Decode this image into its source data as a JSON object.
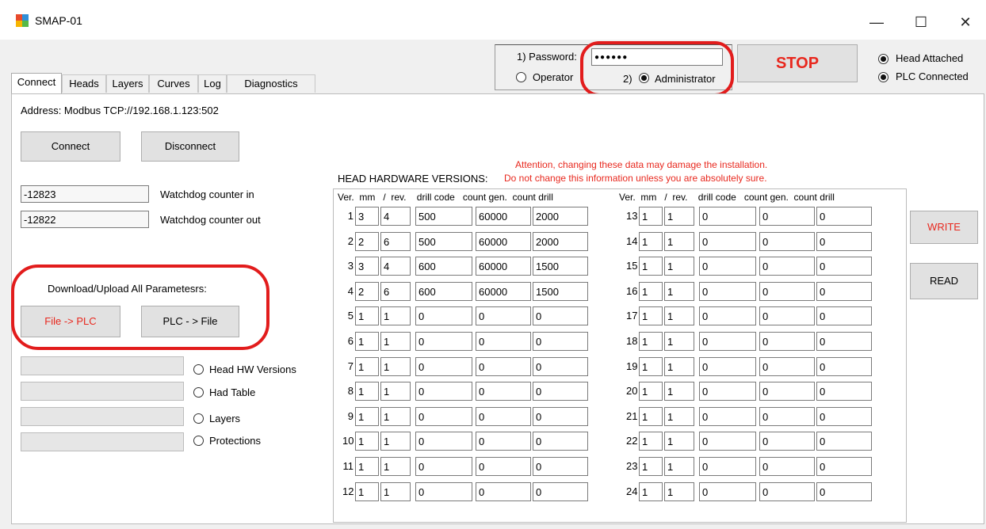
{
  "window": {
    "title": "SMAP-01",
    "minimize": "—",
    "maximize": "☐",
    "close": "✕"
  },
  "tabs": [
    "Connect",
    "Heads",
    "Layers",
    "Curves",
    "Log",
    "Diagnostics"
  ],
  "login": {
    "password_label": "1) Password:",
    "password_value": "●●●●●●",
    "operator_label": "Operator",
    "admin_label": "2)",
    "administrator_label": "Administrator"
  },
  "stop_button": "STOP",
  "status": {
    "head_attached": "Head Attached",
    "plc_connected": "PLC Connected"
  },
  "connect": {
    "address": "Address: Modbus TCP://192.168.1.123:502",
    "connect_btn": "Connect",
    "disconnect_btn": "Disconnect",
    "watchdog_in_value": "-12823",
    "watchdog_in_label": "Watchdog counter in",
    "watchdog_out_value": "-12822",
    "watchdog_out_label": "Watchdog counter out",
    "download_label": "Download/Upload All Parametesrs:",
    "file_to_plc": "File -> PLC",
    "plc_to_file": "PLC - > File",
    "options": [
      "Head HW Versions",
      "Had Table",
      "Layers",
      "Protections"
    ]
  },
  "head_hw": {
    "title": "HEAD HARDWARE VERSIONS:",
    "warning1": "Attention, changing these data may damage the installation.",
    "warning2": "Do not change this information unless you are absolutely sure.",
    "header": "Ver.  mm   /  rev.    drill code   count gen.  count drill",
    "rows_left": [
      [
        "1",
        "3",
        "4",
        "500",
        "60000",
        "2000"
      ],
      [
        "2",
        "2",
        "6",
        "500",
        "60000",
        "2000"
      ],
      [
        "3",
        "3",
        "4",
        "600",
        "60000",
        "1500"
      ],
      [
        "4",
        "2",
        "6",
        "600",
        "60000",
        "1500"
      ],
      [
        "5",
        "1",
        "1",
        "0",
        "0",
        "0"
      ],
      [
        "6",
        "1",
        "1",
        "0",
        "0",
        "0"
      ],
      [
        "7",
        "1",
        "1",
        "0",
        "0",
        "0"
      ],
      [
        "8",
        "1",
        "1",
        "0",
        "0",
        "0"
      ],
      [
        "9",
        "1",
        "1",
        "0",
        "0",
        "0"
      ],
      [
        "10",
        "1",
        "1",
        "0",
        "0",
        "0"
      ],
      [
        "11",
        "1",
        "1",
        "0",
        "0",
        "0"
      ],
      [
        "12",
        "1",
        "1",
        "0",
        "0",
        "0"
      ]
    ],
    "rows_right": [
      [
        "13",
        "1",
        "1",
        "0",
        "0",
        "0"
      ],
      [
        "14",
        "1",
        "1",
        "0",
        "0",
        "0"
      ],
      [
        "15",
        "1",
        "1",
        "0",
        "0",
        "0"
      ],
      [
        "16",
        "1",
        "1",
        "0",
        "0",
        "0"
      ],
      [
        "17",
        "1",
        "1",
        "0",
        "0",
        "0"
      ],
      [
        "18",
        "1",
        "1",
        "0",
        "0",
        "0"
      ],
      [
        "19",
        "1",
        "1",
        "0",
        "0",
        "0"
      ],
      [
        "20",
        "1",
        "1",
        "0",
        "0",
        "0"
      ],
      [
        "21",
        "1",
        "1",
        "0",
        "0",
        "0"
      ],
      [
        "22",
        "1",
        "1",
        "0",
        "0",
        "0"
      ],
      [
        "23",
        "1",
        "1",
        "0",
        "0",
        "0"
      ],
      [
        "24",
        "1",
        "1",
        "0",
        "0",
        "0"
      ]
    ],
    "write_btn": "WRITE",
    "read_btn": "READ"
  },
  "colors": {
    "annotation": "#e21c1c",
    "warning_text": "#e8281e"
  }
}
